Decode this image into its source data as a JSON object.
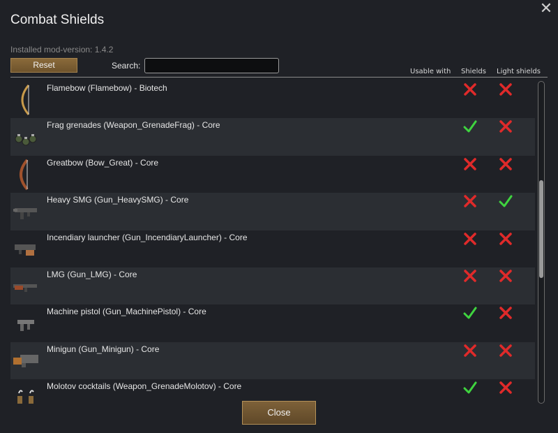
{
  "window": {
    "title": "Combat Shields",
    "close_glyph": "✕",
    "close_icon": "close-icon"
  },
  "version_text": "Installed mod-version: 1.4.2",
  "reset_label": "Reset",
  "search": {
    "label": "Search:",
    "value": "",
    "placeholder": ""
  },
  "columns": {
    "usable_with": "Usable with",
    "shields": "Shields",
    "light_shields": "Light shields"
  },
  "colors": {
    "check": "#3fd43f",
    "cross": "#e02a2a",
    "button": "#7d6139"
  },
  "weapons": [
    {
      "label": "Flamebow (Flamebow) - Biotech",
      "icon": "bow-icon",
      "shields": false,
      "light_shields": false
    },
    {
      "label": "Frag grenades (Weapon_GrenadeFrag) - Core",
      "icon": "grenade-icon",
      "shields": true,
      "light_shields": false
    },
    {
      "label": "Greatbow (Bow_Great) - Core",
      "icon": "greatbow-icon",
      "shields": false,
      "light_shields": false
    },
    {
      "label": "Heavy SMG (Gun_HeavySMG) - Core",
      "icon": "smg-icon",
      "shields": false,
      "light_shields": true
    },
    {
      "label": "Incendiary launcher (Gun_IncendiaryLauncher) - Core",
      "icon": "launcher-icon",
      "shields": false,
      "light_shields": false
    },
    {
      "label": "LMG (Gun_LMG) - Core",
      "icon": "lmg-icon",
      "shields": false,
      "light_shields": false
    },
    {
      "label": "Machine pistol (Gun_MachinePistol) - Core",
      "icon": "pistol-icon",
      "shields": true,
      "light_shields": false
    },
    {
      "label": "Minigun (Gun_Minigun) - Core",
      "icon": "minigun-icon",
      "shields": false,
      "light_shields": false
    },
    {
      "label": "Molotov cocktails (Weapon_GrenadeMolotov) - Core",
      "icon": "molotov-icon",
      "shields": true,
      "light_shields": false
    }
  ],
  "close_label": "Close"
}
